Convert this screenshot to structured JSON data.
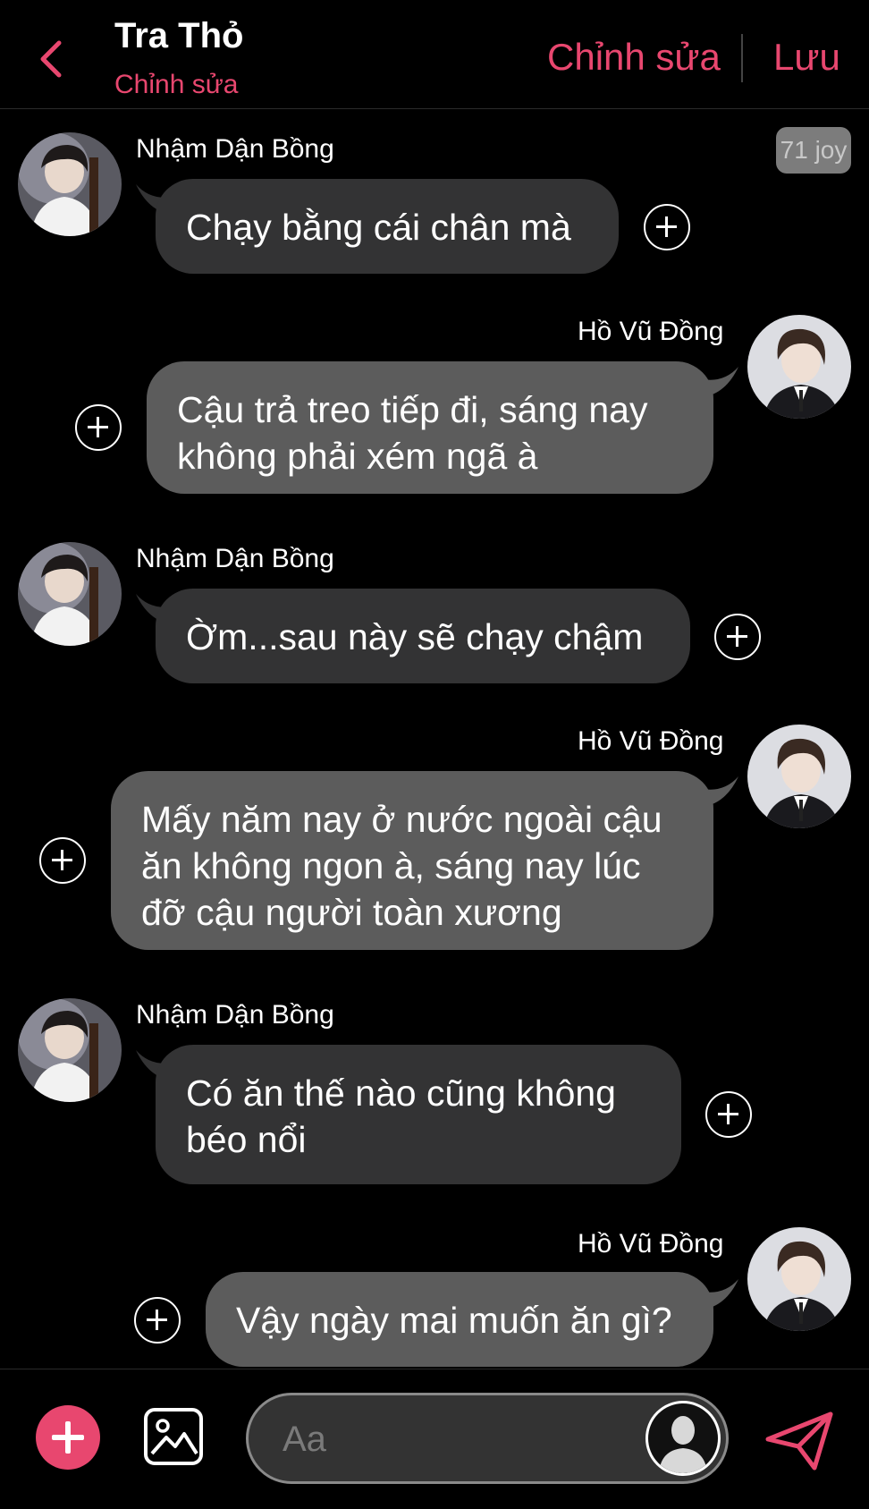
{
  "header": {
    "title": "Tra Thỏ",
    "subtitle": "Chỉnh sửa",
    "edit_label": "Chỉnh sửa",
    "save_label": "Lưu"
  },
  "badge": "71 joy",
  "messages": [
    {
      "sender": "Nhậm Dận Bồng",
      "side": "left",
      "text": "Chạy bằng cái chân mà"
    },
    {
      "sender": "Hồ Vũ Đồng",
      "side": "right",
      "text": "Cậu trả treo tiếp đi, sáng nay không phải xém ngã à"
    },
    {
      "sender": "Nhậm Dận Bồng",
      "side": "left",
      "text": "Ờm...sau này sẽ chạy chậm"
    },
    {
      "sender": "Hồ Vũ Đồng",
      "side": "right",
      "text": "Mấy năm nay ở nước ngoài cậu ăn không ngon à, sáng nay lúc đỡ cậu người toàn xương"
    },
    {
      "sender": "Nhậm Dận Bồng",
      "side": "left",
      "text": "Có ăn thế nào cũng không béo nổi"
    },
    {
      "sender": "Hồ Vũ Đồng",
      "side": "right",
      "text": "Vậy ngày mai muốn ăn gì?"
    }
  ],
  "composer": {
    "placeholder": "Aa"
  },
  "colors": {
    "accent": "#e8476f",
    "bubble_left": "#333334",
    "bubble_right": "#5c5c5c",
    "background": "#000000"
  }
}
